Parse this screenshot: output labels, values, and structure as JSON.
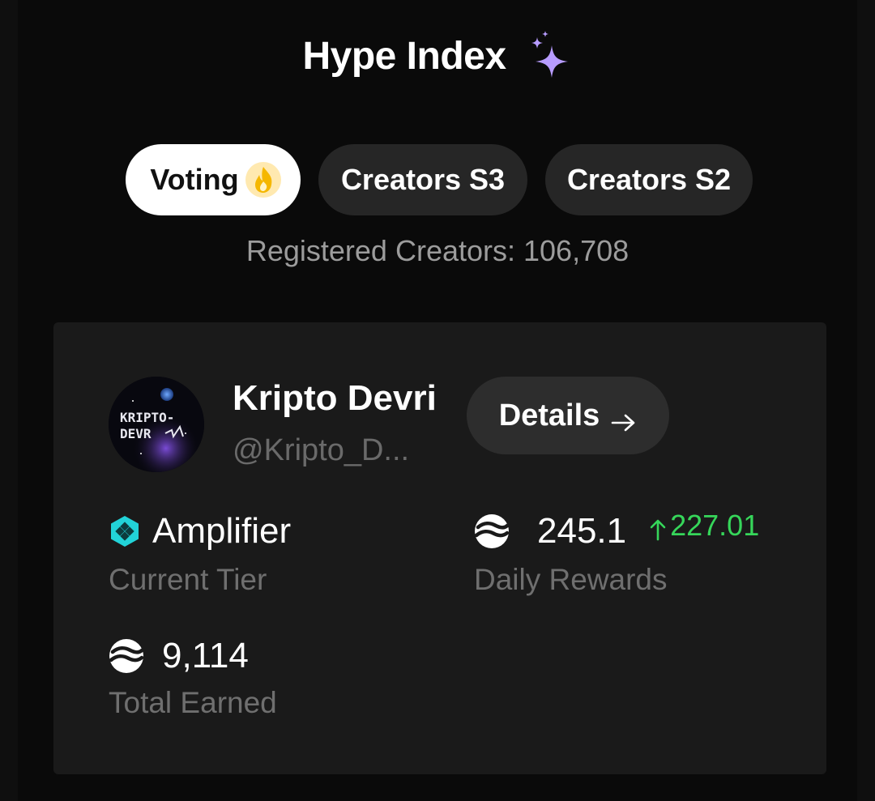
{
  "header": {
    "title": "Hype Index",
    "title_icon": "sparkles-icon"
  },
  "tabs": [
    {
      "label": "Voting",
      "icon": "flame-icon",
      "active": true
    },
    {
      "label": "Creators S3",
      "active": false
    },
    {
      "label": "Creators S2",
      "active": false
    }
  ],
  "registered": "Registered Creators: 106,708",
  "creator": {
    "avatar_text": [
      "KRIPTO-",
      "DEVR"
    ],
    "name": "Kripto Devri",
    "handle": "@Kripto_D...",
    "details_label": "Details"
  },
  "stats": {
    "tier": {
      "value": "Amplifier",
      "label": "Current Tier"
    },
    "daily_rewards": {
      "value": "245.1",
      "change": "227.01",
      "label": "Daily Rewards"
    },
    "total_earned": {
      "value": "9,114",
      "label": "Total Earned"
    }
  },
  "colors": {
    "background": "#0a0a0a",
    "card": "#1a1a1a",
    "accent_sparkle": "#a78bfa",
    "positive": "#36d65a",
    "tier_hex": "#22d3d8"
  }
}
